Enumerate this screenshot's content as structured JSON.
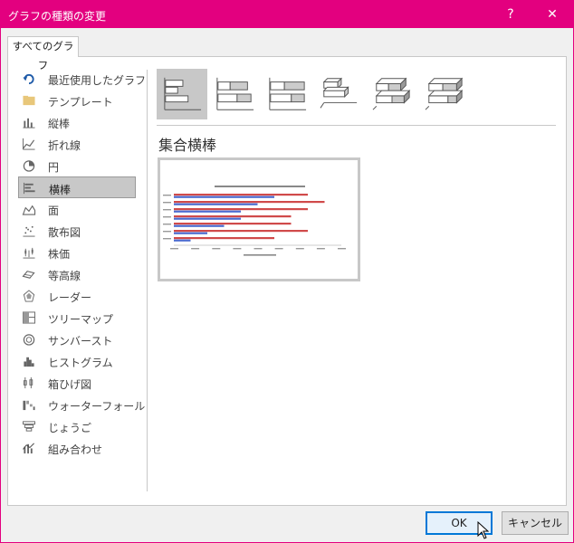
{
  "window": {
    "title": "グラフの種類の変更",
    "help": "?",
    "close": "✕"
  },
  "tab": {
    "label": "すべてのグラフ"
  },
  "sidebar": {
    "items": [
      {
        "label": "最近使用したグラフ",
        "icon": "recent-icon"
      },
      {
        "label": "テンプレート",
        "icon": "folder-icon"
      },
      {
        "label": "縦棒",
        "icon": "column-chart-icon"
      },
      {
        "label": "折れ線",
        "icon": "line-chart-icon"
      },
      {
        "label": "円",
        "icon": "pie-chart-icon"
      },
      {
        "label": "横棒",
        "icon": "bar-chart-icon",
        "selected": true
      },
      {
        "label": "面",
        "icon": "area-chart-icon"
      },
      {
        "label": "散布図",
        "icon": "scatter-chart-icon"
      },
      {
        "label": "株価",
        "icon": "stock-chart-icon"
      },
      {
        "label": "等高線",
        "icon": "surface-chart-icon"
      },
      {
        "label": "レーダー",
        "icon": "radar-chart-icon"
      },
      {
        "label": "ツリーマップ",
        "icon": "treemap-icon"
      },
      {
        "label": "サンバースト",
        "icon": "sunburst-icon"
      },
      {
        "label": "ヒストグラム",
        "icon": "histogram-icon"
      },
      {
        "label": "箱ひげ図",
        "icon": "box-whisker-icon"
      },
      {
        "label": "ウォーターフォール",
        "icon": "waterfall-icon"
      },
      {
        "label": "じょうご",
        "icon": "funnel-icon"
      },
      {
        "label": "組み合わせ",
        "icon": "combo-chart-icon"
      }
    ]
  },
  "subtypes": [
    {
      "name": "clustered-bar",
      "selected": true
    },
    {
      "name": "stacked-bar"
    },
    {
      "name": "100-stacked-bar"
    },
    {
      "name": "3d-clustered-bar"
    },
    {
      "name": "3d-stacked-bar"
    },
    {
      "name": "3d-100-stacked-bar"
    }
  ],
  "chart_name": "集合横棒",
  "preview": {
    "chart_data": {
      "type": "bar",
      "series": [
        {
          "color": "#d04a4a",
          "values": [
            8,
            9,
            8,
            7,
            7,
            8,
            6
          ]
        },
        {
          "color": "#4a6bd0",
          "values": [
            6,
            5,
            4,
            4,
            3,
            2,
            1
          ]
        }
      ],
      "xlim": [
        0,
        10
      ]
    }
  },
  "buttons": {
    "ok": "OK",
    "cancel": "キャンセル"
  },
  "colors": {
    "accent": "#e3007f",
    "selection": "#c8c8c8"
  }
}
